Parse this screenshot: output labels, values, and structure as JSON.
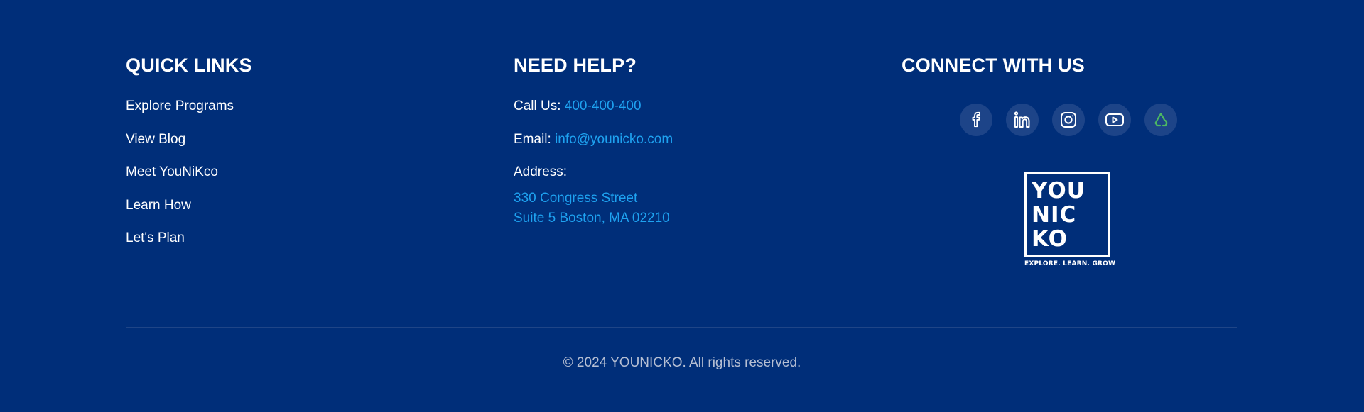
{
  "quick_links": {
    "title": "QUICK LINKS",
    "items": [
      {
        "label": "Explore Programs"
      },
      {
        "label": "View Blog"
      },
      {
        "label": "Meet YouNiKco"
      },
      {
        "label": "Learn How"
      },
      {
        "label": "Let's Plan"
      }
    ]
  },
  "help": {
    "title": "NEED HELP?",
    "call_label": "Call Us:",
    "phone": "400-400-400",
    "email_label": "Email:",
    "email": "info@younicko.com",
    "address_label": "Address:",
    "address_line1": "330 Congress Street",
    "address_line2": "Suite 5 Boston, MA 02210"
  },
  "connect": {
    "title": "CONNECT WITH US",
    "socials": [
      {
        "icon": "facebook-icon"
      },
      {
        "icon": "linkedin-icon"
      },
      {
        "icon": "instagram-icon"
      },
      {
        "icon": "youtube-icon"
      },
      {
        "icon": "recycle-icon"
      }
    ],
    "logo": {
      "line1": "YOU",
      "line2": "NIC",
      "line3": "KO",
      "tagline": "EXPLORE. LEARN. GROW"
    }
  },
  "copyright": "© 2024 YOUNICKO. All rights reserved.",
  "colors": {
    "background": "#002e79",
    "accent_link": "#1ea2f0",
    "social_button": "#1d4488",
    "recycle_icon": "#4cb862"
  }
}
